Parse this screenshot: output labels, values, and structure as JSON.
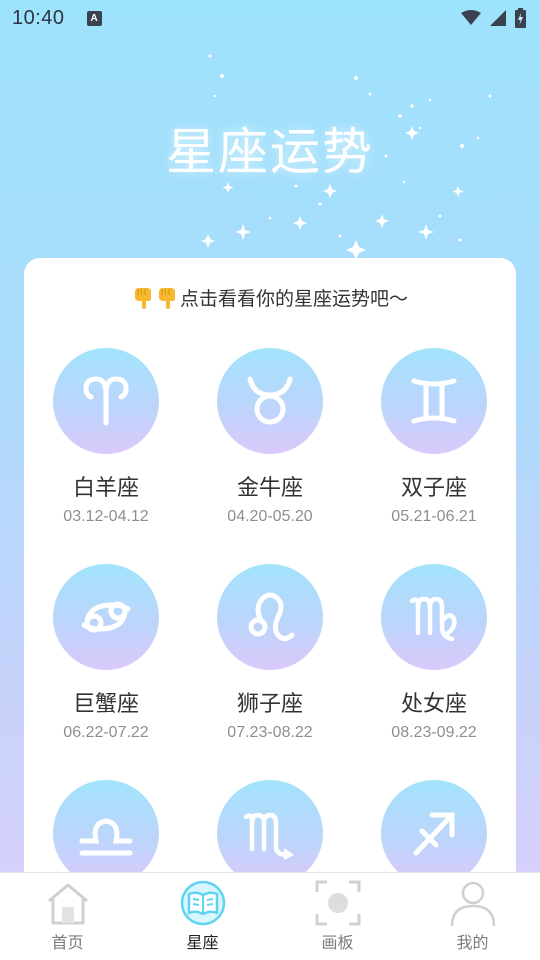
{
  "status_bar": {
    "time": "10:40",
    "app_badge": "A",
    "icons": [
      "wifi-icon",
      "signal-icon",
      "battery-icon"
    ]
  },
  "hero": {
    "title": "星座运势"
  },
  "card": {
    "prompt_emoji": [
      "hand-pointing-down-icon",
      "hand-pointing-down-icon"
    ],
    "prompt": "点击看看你的星座运势吧～",
    "zodiacs": [
      {
        "name": "白羊座",
        "date": "03.12-04.12",
        "icon": "aries-icon"
      },
      {
        "name": "金牛座",
        "date": "04.20-05.20",
        "icon": "taurus-icon"
      },
      {
        "name": "双子座",
        "date": "05.21-06.21",
        "icon": "gemini-icon"
      },
      {
        "name": "巨蟹座",
        "date": "06.22-07.22",
        "icon": "cancer-icon"
      },
      {
        "name": "狮子座",
        "date": "07.23-08.22",
        "icon": "leo-icon"
      },
      {
        "name": "处女座",
        "date": "08.23-09.22",
        "icon": "virgo-icon"
      },
      {
        "name": "",
        "date": "",
        "icon": "libra-icon"
      },
      {
        "name": "",
        "date": "",
        "icon": "scorpio-icon"
      },
      {
        "name": "",
        "date": "",
        "icon": "sagittarius-icon"
      }
    ]
  },
  "bottom_nav": {
    "items": [
      {
        "label": "首页",
        "icon": "home-icon",
        "active": false
      },
      {
        "label": "星座",
        "icon": "book-icon",
        "active": true
      },
      {
        "label": "画板",
        "icon": "camera-frame-icon",
        "active": false
      },
      {
        "label": "我的",
        "icon": "person-icon",
        "active": false
      }
    ]
  },
  "colors": {
    "accent": "#5fd3f0",
    "gradient_top": "#9ee3fc",
    "gradient_bottom": "#dccffc",
    "text_primary": "#333333",
    "text_secondary": "#8e8e8e"
  }
}
